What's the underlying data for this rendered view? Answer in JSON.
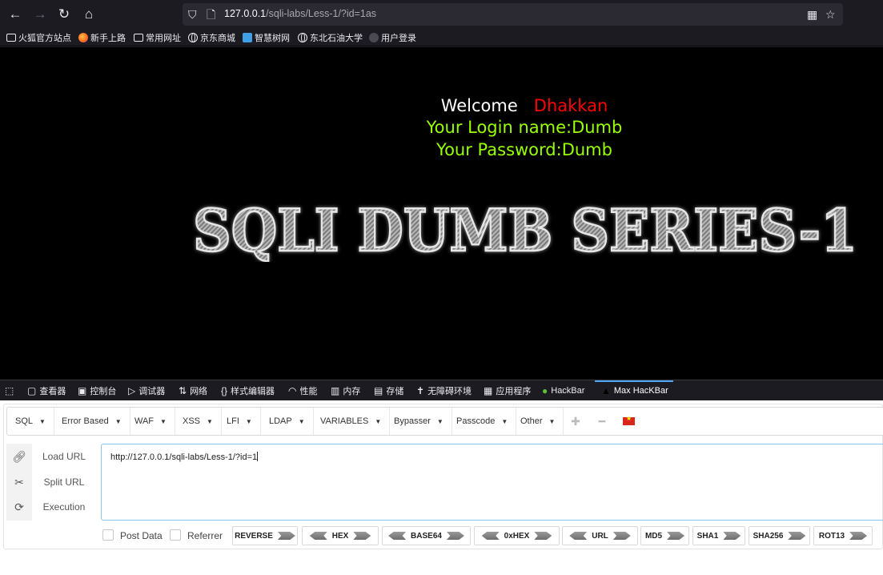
{
  "browser": {
    "url_host": "127.0.0.1",
    "url_path": "/sqli-labs/Less-1/?id=1as"
  },
  "bookmarks": [
    {
      "label": "火狐官方站点",
      "icon": "folder-icon"
    },
    {
      "label": "新手上路",
      "icon": "firefox-icon"
    },
    {
      "label": "常用网址",
      "icon": "folder-icon"
    },
    {
      "label": "京东商城",
      "icon": "globe-icon"
    },
    {
      "label": "智慧树网",
      "icon": "zhihuishu-icon"
    },
    {
      "label": "东北石油大学",
      "icon": "globe-icon"
    },
    {
      "label": "用户登录",
      "icon": "user-icon"
    }
  ],
  "page": {
    "welcome": "Welcome",
    "welcome_name": "Dhakkan",
    "login_name": "Your Login name:Dumb",
    "password": "Your Password:Dumb",
    "banner_title": "SQLI DUMB SERIES-1"
  },
  "devtools": {
    "tabs": [
      "查看器",
      "控制台",
      "调试器",
      "网络",
      "样式编辑器",
      "性能",
      "内存",
      "存储",
      "无障碍环境",
      "应用程序",
      "HackBar",
      "Max HacKBar"
    ],
    "active_tab": "Max HacKBar"
  },
  "hackbar": {
    "menus": [
      "SQL",
      "Error Based",
      "WAF",
      "XSS",
      "LFI",
      "LDAP",
      "VARIABLES",
      "Bypasser",
      "Passcode",
      "Other"
    ],
    "actions": [
      "Load URL",
      "Split URL",
      "Execution"
    ],
    "url_value": "http://127.0.0.1/sqli-labs/Less-1/?id=1",
    "post_data_label": "Post Data",
    "referrer_label": "Referrer",
    "encoders": [
      "REVERSE",
      "HEX",
      "BASE64",
      "0xHEX",
      "URL",
      "MD5",
      "SHA1",
      "SHA256",
      "ROT13"
    ]
  },
  "colors": {
    "welcome_name": "#ff0000",
    "login_text": "#99ff00",
    "active_tab_indicator": "#4fa5f3"
  }
}
